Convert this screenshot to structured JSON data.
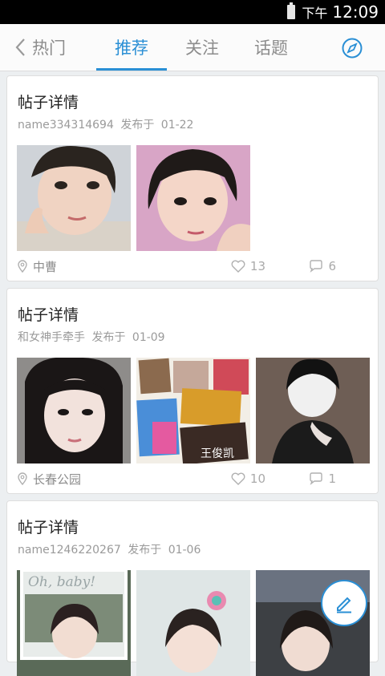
{
  "status_bar": {
    "ampm": "下午",
    "time": "12:09"
  },
  "nav": {
    "tabs": [
      {
        "label": "热门"
      },
      {
        "label": "推荐"
      },
      {
        "label": "关注"
      },
      {
        "label": "话题"
      }
    ],
    "active_tab": "推荐"
  },
  "posts": [
    {
      "title": "帖子详情",
      "author": "name334314694",
      "posted_label": "发布于",
      "date": "01-22",
      "location": "中曹",
      "likes": "13",
      "comments": "6"
    },
    {
      "title": "帖子详情",
      "author": "和女神手牵手",
      "posted_label": "发布于",
      "date": "01-09",
      "location": "长春公园",
      "likes": "10",
      "comments": "1"
    },
    {
      "title": "帖子详情",
      "author": "name1246220267",
      "posted_label": "发布于",
      "date": "01-06"
    }
  ],
  "photo_texts": {
    "collage_caption": "王俊凯",
    "oh_baby": "Oh, baby!"
  },
  "colors": {
    "accent": "#2a8fd5",
    "background": "#eceff1",
    "card": "#ffffff",
    "muted": "#9a9a9a"
  }
}
